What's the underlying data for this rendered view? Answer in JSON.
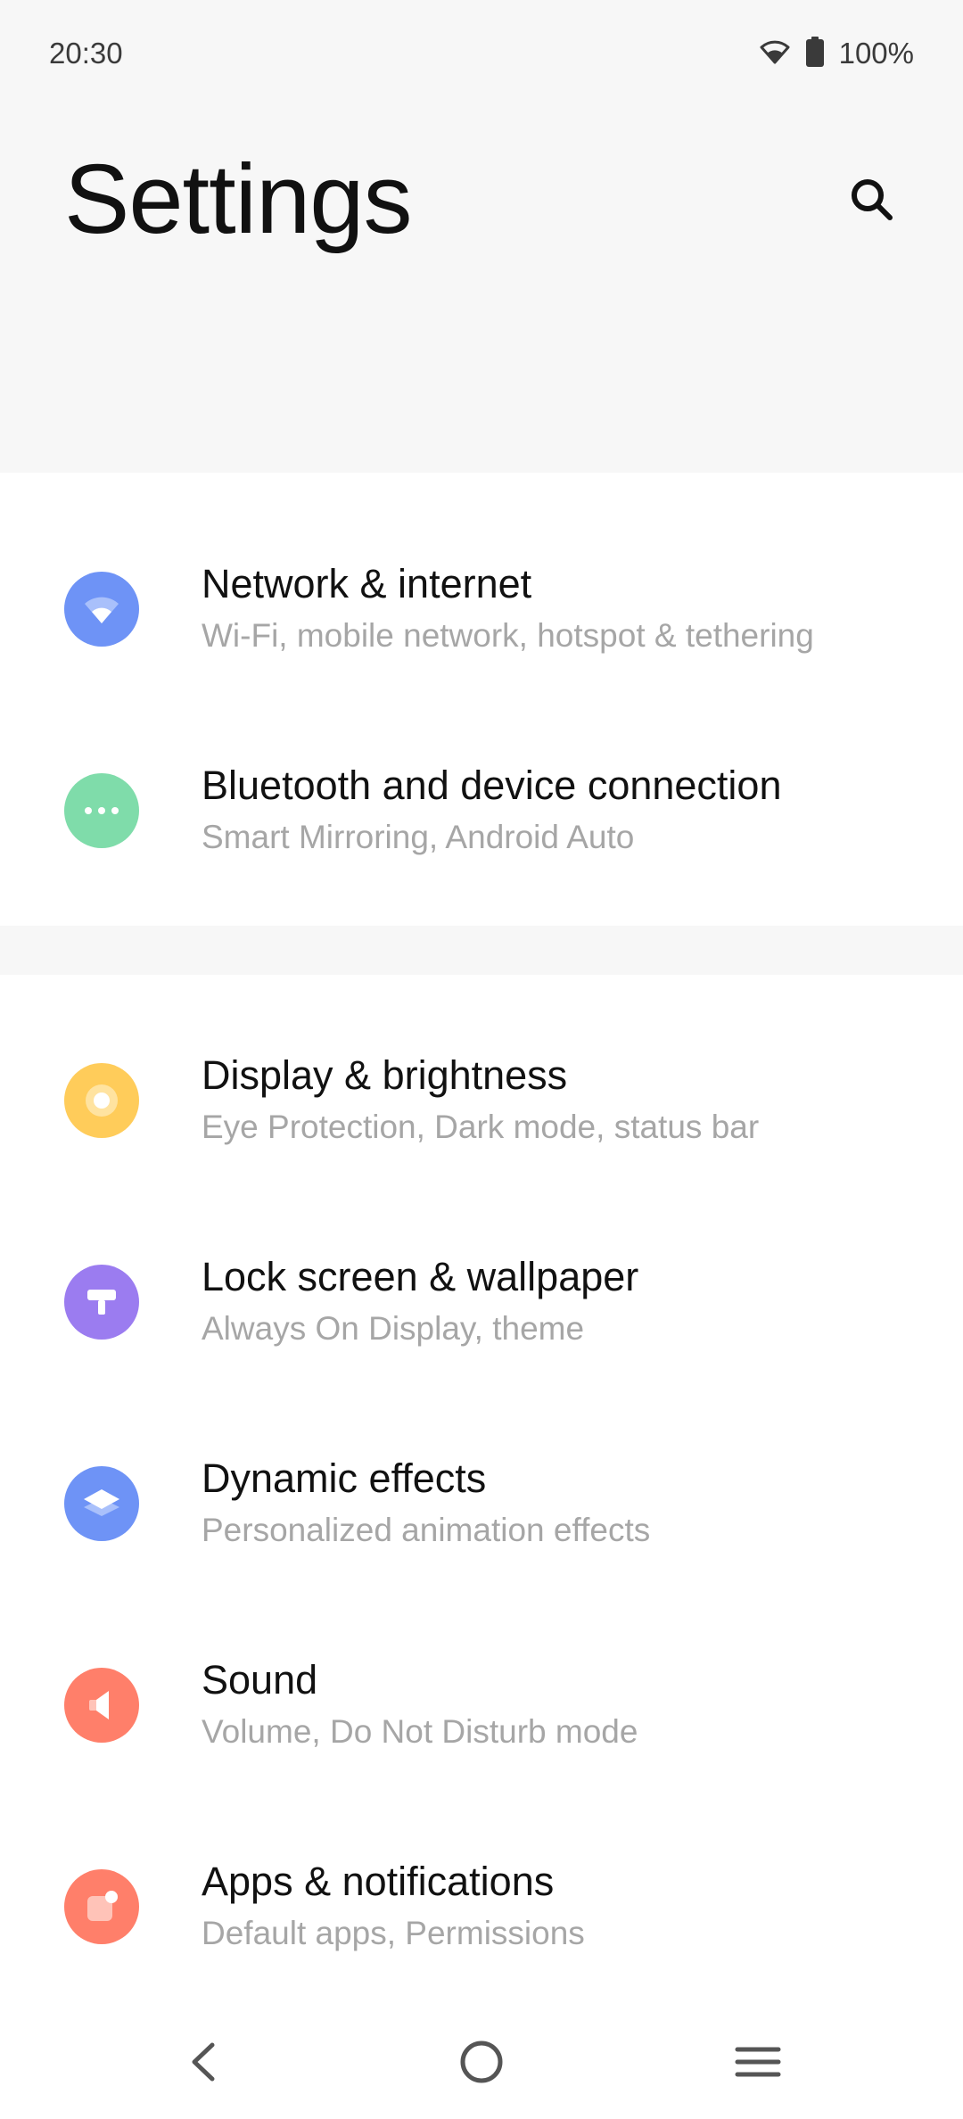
{
  "status_bar": {
    "time": "20:30",
    "battery_text": "100%",
    "icons": [
      "wifi-icon",
      "battery-icon"
    ]
  },
  "header": {
    "title": "Settings",
    "search_icon": "search-icon"
  },
  "sections": [
    {
      "items": [
        {
          "title": "Network & internet",
          "subtitle": "Wi-Fi, mobile network, hotspot & tethering",
          "icon": "wifi-icon",
          "color": "#6e93f6"
        },
        {
          "title": "Bluetooth and device connection",
          "subtitle": "Smart Mirroring, Android Auto",
          "icon": "more-dots-icon",
          "color": "#7fdcaa"
        }
      ]
    },
    {
      "items": [
        {
          "title": "Display & brightness",
          "subtitle": "Eye Protection, Dark mode, status bar",
          "icon": "brightness-icon",
          "color": "#ffcc5a"
        },
        {
          "title": "Lock screen & wallpaper",
          "subtitle": "Always On Display, theme",
          "icon": "paint-roller-icon",
          "color": "#9b7cf0"
        },
        {
          "title": "Dynamic effects",
          "subtitle": "Personalized animation effects",
          "icon": "layers-icon",
          "color": "#6e93f6"
        },
        {
          "title": "Sound",
          "subtitle": "Volume, Do Not Disturb mode",
          "icon": "speaker-icon",
          "color": "#ff7f6a"
        },
        {
          "title": "Apps & notifications",
          "subtitle": "Default apps, Permissions",
          "icon": "apps-notification-icon",
          "color": "#ff7f6a"
        }
      ]
    }
  ],
  "nav_bar": {
    "icons": [
      "back-icon",
      "home-icon",
      "menu-icon"
    ]
  }
}
